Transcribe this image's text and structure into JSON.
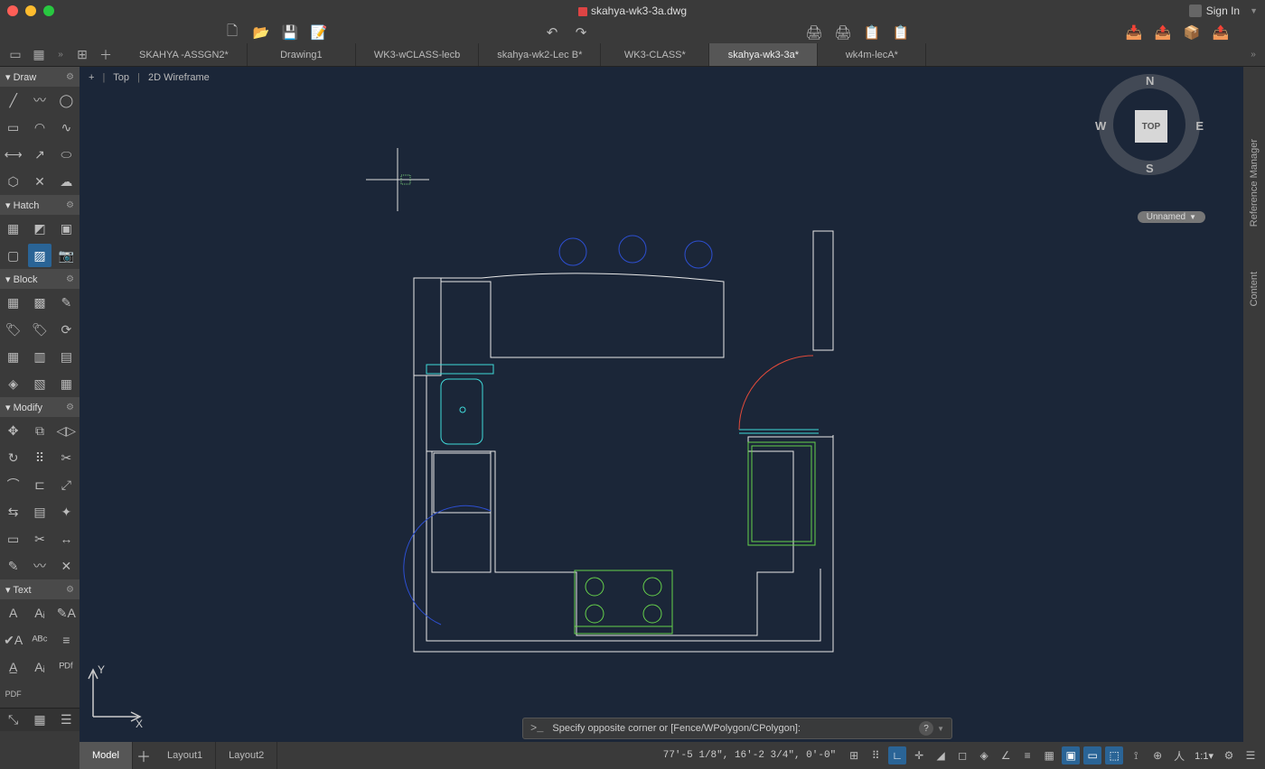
{
  "window": {
    "title": "skahya-wk3-3a.dwg",
    "signin": "Sign In"
  },
  "doc_tabs": [
    {
      "label": "SKAHYA -ASSGN2*",
      "active": false
    },
    {
      "label": "Drawing1",
      "active": false
    },
    {
      "label": "WK3-wCLASS-lecb",
      "active": false
    },
    {
      "label": "skahya-wk2-Lec B*",
      "active": false
    },
    {
      "label": "WK3-CLASS*",
      "active": false
    },
    {
      "label": "skahya-wk3-3a*",
      "active": true
    },
    {
      "label": "wk4m-lecA*",
      "active": false
    }
  ],
  "viewport": {
    "plus": "+",
    "view": "Top",
    "style": "2D Wireframe"
  },
  "viewcube": {
    "face": "TOP",
    "n": "N",
    "s": "S",
    "e": "E",
    "w": "W",
    "dropdown": "Unnamed"
  },
  "palette": {
    "draw": "Draw",
    "hatch": "Hatch",
    "block": "Block",
    "modify": "Modify",
    "text": "Text"
  },
  "right_tabs": {
    "ref": "Reference Manager",
    "content": "Content"
  },
  "cmd": {
    "prompt_icon": ">_",
    "prompt": "Specify opposite corner or [Fence/WPolygon/CPolygon]:",
    "help": "?"
  },
  "bottom_tabs": [
    {
      "label": "Model",
      "active": true
    },
    {
      "label": "Layout1",
      "active": false
    },
    {
      "label": "Layout2",
      "active": false
    }
  ],
  "coords": "77'-5 1/8\",  16'-2 3/4\",  0'-0\"",
  "status": {
    "scale": "1:1",
    "annoscale": "▲"
  },
  "traffic": {
    "close": "#ff5f57",
    "min": "#febc2e",
    "max": "#28c840"
  }
}
